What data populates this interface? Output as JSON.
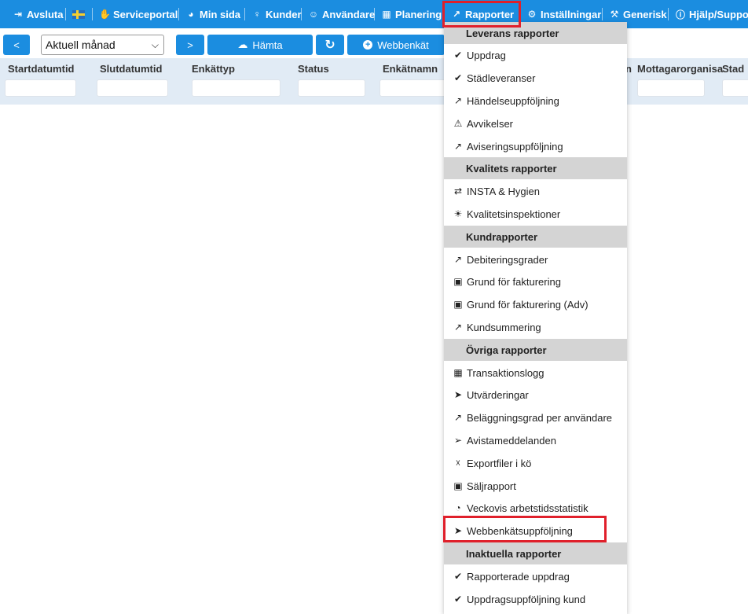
{
  "nav": {
    "items": [
      {
        "label": "Avsluta",
        "icon": "sign-out-icon",
        "glyph": "⇥"
      },
      {
        "label": "",
        "icon": "swedish-flag-icon",
        "glyph": ""
      },
      {
        "label": "Serviceportal",
        "icon": "handshake-icon",
        "glyph": "✋"
      },
      {
        "label": "Min sida",
        "icon": "dashboard-icon",
        "glyph": "◕"
      },
      {
        "label": "Kunder",
        "icon": "user-tie-icon",
        "glyph": "♀"
      },
      {
        "label": "Användare",
        "icon": "user-icon",
        "glyph": "☺"
      },
      {
        "label": "Planering",
        "icon": "calendar-icon",
        "glyph": "▦"
      },
      {
        "label": "Rapporter",
        "icon": "line-chart-icon",
        "glyph": "↗"
      },
      {
        "label": "Inställningar",
        "icon": "cogs-icon",
        "glyph": "⚙"
      },
      {
        "label": "Generisk",
        "icon": "wrench-icon",
        "glyph": "⚒"
      },
      {
        "label": "Hjälp/Support",
        "icon": "info-icon",
        "glyph": "ⓘ"
      }
    ]
  },
  "toolbar": {
    "prev_label": "<",
    "period_value": "Aktuell månad",
    "next_label": ">",
    "fetch_label": "Hämta",
    "refresh_glyph": "↻",
    "webenkat_label": "Webbenkät"
  },
  "columns": [
    {
      "label": "Startdatumtid"
    },
    {
      "label": "Slutdatumtid"
    },
    {
      "label": "Enkättyp"
    },
    {
      "label": "Status"
    },
    {
      "label": "Enkätnamn"
    },
    {
      "label": "n"
    },
    {
      "label": "Mottagarorganisa"
    },
    {
      "label": "Stad"
    }
  ],
  "menu": {
    "sections": [
      {
        "title": "Leverans rapporter",
        "items": [
          {
            "label": "Uppdrag",
            "icon": "check-circle-icon",
            "glyph": "✔"
          },
          {
            "label": "Städleveranser",
            "icon": "check-circle-icon",
            "glyph": "✔"
          },
          {
            "label": "Händelseuppföljning",
            "icon": "line-chart-icon",
            "glyph": "↗"
          },
          {
            "label": "Avvikelser",
            "icon": "warning-icon",
            "glyph": "⚠"
          },
          {
            "label": "Aviseringsuppföljning",
            "icon": "line-chart-icon",
            "glyph": "↗"
          }
        ]
      },
      {
        "title": "Kvalitets rapporter",
        "items": [
          {
            "label": "INSTA & Hygien",
            "icon": "random-icon",
            "glyph": "⇄"
          },
          {
            "label": "Kvalitetsinspektioner",
            "icon": "lightbulb-icon",
            "glyph": "☀"
          }
        ]
      },
      {
        "title": "Kundrapporter",
        "items": [
          {
            "label": "Debiteringsgrader",
            "icon": "line-chart-icon",
            "glyph": "↗"
          },
          {
            "label": "Grund för fakturering",
            "icon": "money-icon",
            "glyph": "▣"
          },
          {
            "label": "Grund för fakturering (Adv)",
            "icon": "money-icon",
            "glyph": "▣"
          },
          {
            "label": "Kundsummering",
            "icon": "line-chart-icon",
            "glyph": "↗"
          }
        ]
      },
      {
        "title": "Övriga rapporter",
        "items": [
          {
            "label": "Transaktionslogg",
            "icon": "table-icon",
            "glyph": "▦"
          },
          {
            "label": "Utvärderingar",
            "icon": "paper-plane-icon",
            "glyph": "➤"
          },
          {
            "label": "Beläggningsgrad per användare",
            "icon": "line-chart-icon",
            "glyph": "↗"
          },
          {
            "label": "Avistameddelanden",
            "icon": "paper-plane-outline-icon",
            "glyph": "➢"
          },
          {
            "label": "Exportfiler i kö",
            "icon": "file-excel-icon",
            "glyph": "☓"
          },
          {
            "label": "Säljrapport",
            "icon": "money-icon",
            "glyph": "▣"
          },
          {
            "label": "Veckovis arbetstidsstatistik",
            "icon": "pie-chart-icon",
            "glyph": "◔"
          },
          {
            "label": "Webbenkätsuppföljning",
            "icon": "paper-plane-icon",
            "glyph": "➤"
          }
        ]
      },
      {
        "title": "Inaktuella rapporter",
        "items": [
          {
            "label": "Rapporterade uppdrag",
            "icon": "check-circle-icon",
            "glyph": "✔"
          },
          {
            "label": "Uppdragsuppföljning kund",
            "icon": "check-circle-icon",
            "glyph": "✔"
          }
        ]
      }
    ]
  },
  "colors": {
    "primary": "#1b8de0",
    "highlight": "#e0202b",
    "header_bg": "#e1ebf5",
    "section_bg": "#d4d4d4"
  }
}
